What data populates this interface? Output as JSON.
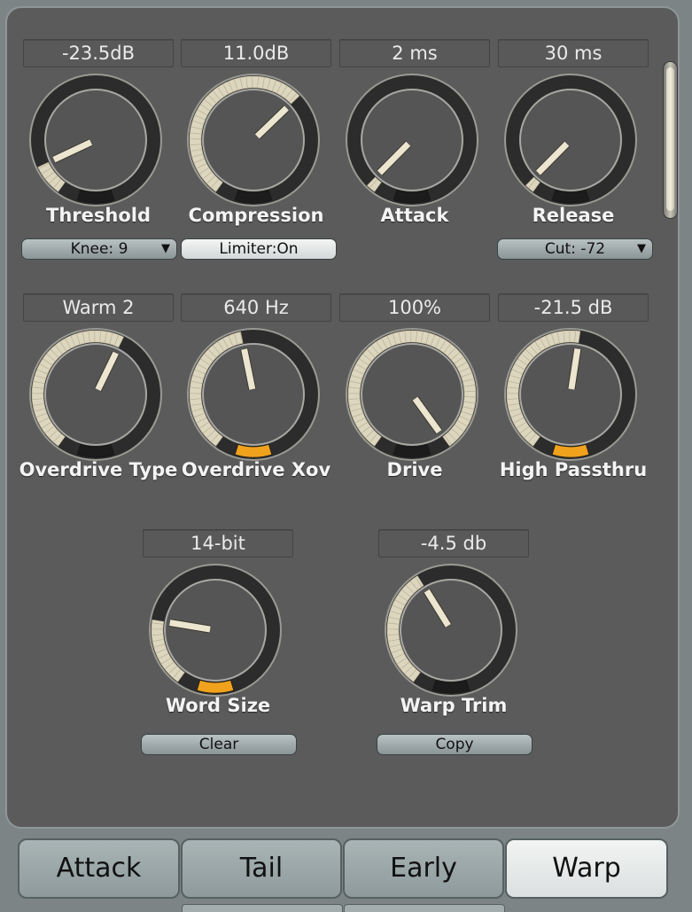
{
  "knobs": [
    {
      "label": "Threshold",
      "value": "-23.5dB",
      "level": 0.1,
      "tint": "cream"
    },
    {
      "label": "Compression",
      "value": "11.0dB",
      "level": 0.66,
      "tint": "cream"
    },
    {
      "label": "Attack",
      "value": "2 ms",
      "level": 0.03,
      "tint": "cream"
    },
    {
      "label": "Release",
      "value": "30 ms",
      "level": 0.03,
      "tint": "cream"
    },
    {
      "label": "Overdrive Type",
      "value": "Warm 2",
      "level": 0.59,
      "tint": "cream"
    },
    {
      "label": "Overdrive Xov",
      "value": "640 Hz",
      "level": 0.46,
      "tint": "amber"
    },
    {
      "label": "Drive",
      "value": "100%",
      "level": 1.0,
      "tint": "cream"
    },
    {
      "label": "High Passthru",
      "value": "-21.5 dB",
      "level": 0.53,
      "tint": "amber"
    },
    {
      "label": "Word Size",
      "value": "14-bit",
      "level": 0.22,
      "tint": "amber"
    },
    {
      "label": "Warp Trim",
      "value": "-4.5 db",
      "level": 0.39,
      "tint": "cream"
    }
  ],
  "controls": {
    "knee": "Knee: 9",
    "limiter": "Limiter:On",
    "cut": "Cut: -72",
    "clear": "Clear",
    "copy": "Copy",
    "dropdown_arrow": "▼"
  },
  "tabs": [
    "Attack",
    "Tail",
    "Early",
    "Warp"
  ],
  "active_tab": "Warp",
  "colors": {
    "panel": "#5b5b5b",
    "ring_dark": "#2c2c2c",
    "ring_cream": "#ddd6bf",
    "amber": "#f0a21c",
    "pointer": "#ece5cf"
  }
}
